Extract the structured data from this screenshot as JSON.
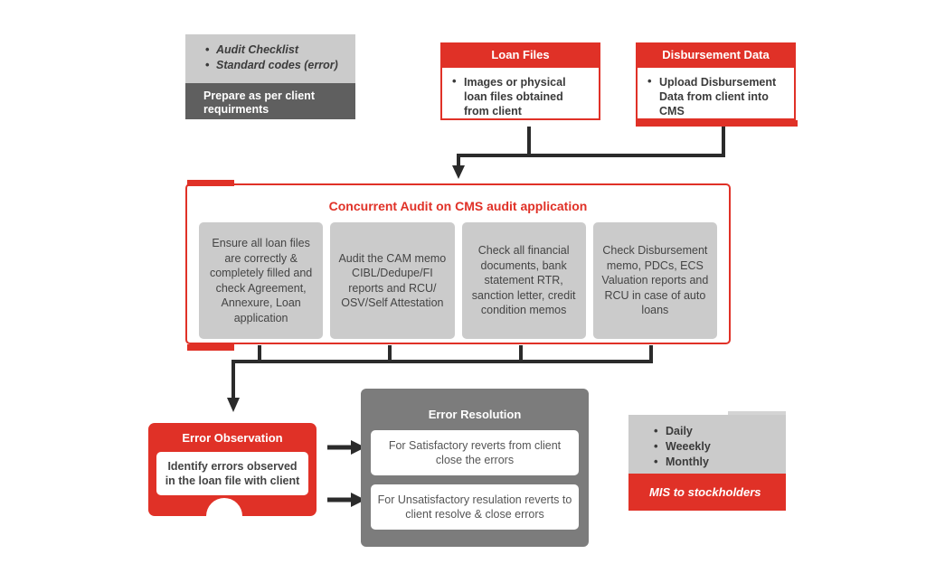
{
  "diagram": {
    "prepare_card": {
      "items": [
        "Audit Checklist",
        "Standard codes (error)"
      ],
      "footer": "Prepare as per client requirments"
    },
    "loan_files": {
      "title": "Loan Files",
      "items": [
        "Images or physical loan files obtained from client"
      ]
    },
    "disbursement_data": {
      "title": "Disbursement Data",
      "items": [
        "Upload Disbursement Data from client into CMS"
      ]
    },
    "audit": {
      "title": "Concurrent Audit on CMS audit application",
      "columns": [
        "Ensure all loan files are correctly  & completely filled and check Agreement, Annexure, Loan application",
        "Audit the CAM memo CIBL/Dedupe/FI reports and RCU/ OSV/Self Attestation",
        "Check all financial documents, bank statement RTR, sanction letter, credit condition memos",
        "Check Disbursement memo, PDCs, ECS Valuation reports and RCU in case of auto loans"
      ]
    },
    "error_observation": {
      "title": "Error Observation",
      "body": "Identify errors observed in the loan file with client"
    },
    "error_resolution": {
      "title": "Error Resolution",
      "items": [
        "For Satisfactory reverts from client close the errors",
        "For Unsatisfactory resulation reverts to client  resolve & close errors"
      ]
    },
    "mis": {
      "items": [
        "Daily",
        "Weeekly",
        "Monthly"
      ],
      "footer": "MIS to stockholders"
    },
    "colors": {
      "red": "#e03127",
      "light_gray": "#cbcbcb",
      "dark_gray": "#5f5f5f",
      "panel_gray": "#7c7c7c",
      "connector": "#2b2b2b"
    }
  }
}
